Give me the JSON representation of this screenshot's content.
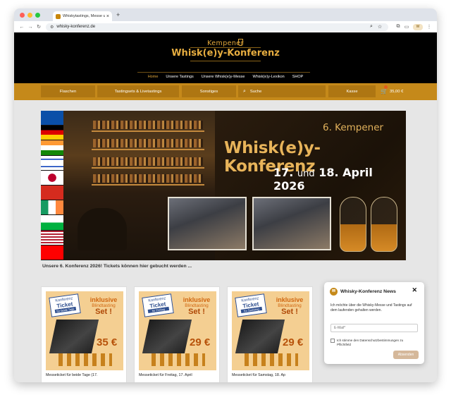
{
  "browser": {
    "tab_title": "Whiskytastings, Messe und ...",
    "tab_close": "×",
    "new_tab": "+",
    "url": "whisky-konferenz.de",
    "profile_label": "W"
  },
  "site": {
    "logo_top": "Kempener",
    "logo_main": "Whisk(e)y-Konferenz",
    "main_nav": [
      "Home",
      "Unsere Tastings",
      "Unsere Whisk(e)y-Messe",
      "Whisk(e)y-Lexikon",
      "SHOP"
    ],
    "shop_nav": {
      "flaschen": "Flaschen",
      "tastingsets": "Tastingsets & Livetastings",
      "sonstiges": "Sonstiges",
      "search_placeholder": "Suche",
      "kasse": "Kasse",
      "cart_total": "35,00 €"
    }
  },
  "banner": {
    "subtitle": "6. Kempener",
    "title": "Whisk(e)y-Konferenz",
    "date_day1": "17.",
    "date_und": "und",
    "date_rest": "18. April 2026"
  },
  "caption": "Unsere 6. Konferenz 2026! Tickets können hier gebucht werden ...",
  "products": [
    {
      "ticket_top": "Konferenz",
      "ticket_main": "Ticket",
      "ticket_sub": "für beide Tage",
      "incl": "inklusive",
      "blind": "Blindtasting",
      "set": "Set !",
      "price": "35 €",
      "title": "Messeticket für beide Tage (17."
    },
    {
      "ticket_top": "Konferenz",
      "ticket_main": "Ticket",
      "ticket_sub": "für Freitag",
      "incl": "inklusive",
      "blind": "Blindtasting",
      "set": "Set !",
      "price": "29 €",
      "title": "Messeticket für Freitag, 17. April"
    },
    {
      "ticket_top": "Konferenz",
      "ticket_main": "Ticket",
      "ticket_sub": "für Samstag",
      "incl": "inklusive",
      "blind": "Blindtasting",
      "set": "Set !",
      "price": "29 €",
      "title": "Messeticket für Samstag, 18. Ap"
    }
  ],
  "newsletter": {
    "title": "Whisky-Konferenz News",
    "close": "✕",
    "text": "Ich möchte über die Whisky-Messe und Tastings auf dem laufenden gehalten werden.",
    "email_placeholder": "E-Mail*",
    "consent": "Ich stimme den Datenschutzbestimmungen zu",
    "consent_required": "Pflichtfeld",
    "submit": "Absenden"
  }
}
